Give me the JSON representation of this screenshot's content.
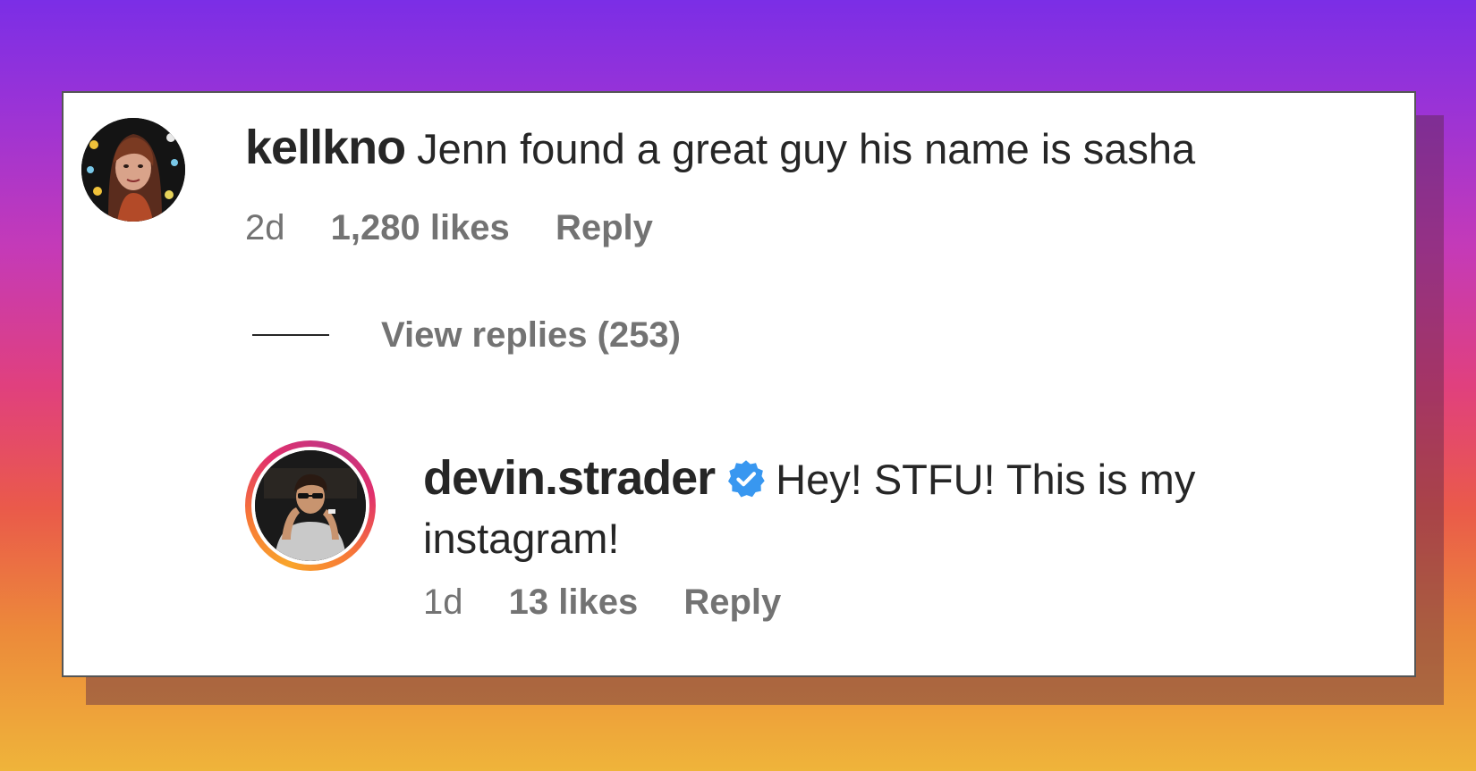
{
  "comments": [
    {
      "username": "kellkno",
      "text": "Jenn found a great guy his name is sasha",
      "time": "2d",
      "likes": "1,280 likes",
      "reply": "Reply",
      "view_replies": "View replies (253)"
    },
    {
      "username": "devin.strader",
      "verified": true,
      "text": "Hey! STFU! This is my instagram!",
      "time": "1d",
      "likes": "13 likes",
      "reply": "Reply"
    }
  ],
  "colors": {
    "primary_text": "#262626",
    "secondary_text": "#737373",
    "verified_badge": "#3897f0"
  },
  "icons": {
    "verified": "verified-badge-icon"
  }
}
